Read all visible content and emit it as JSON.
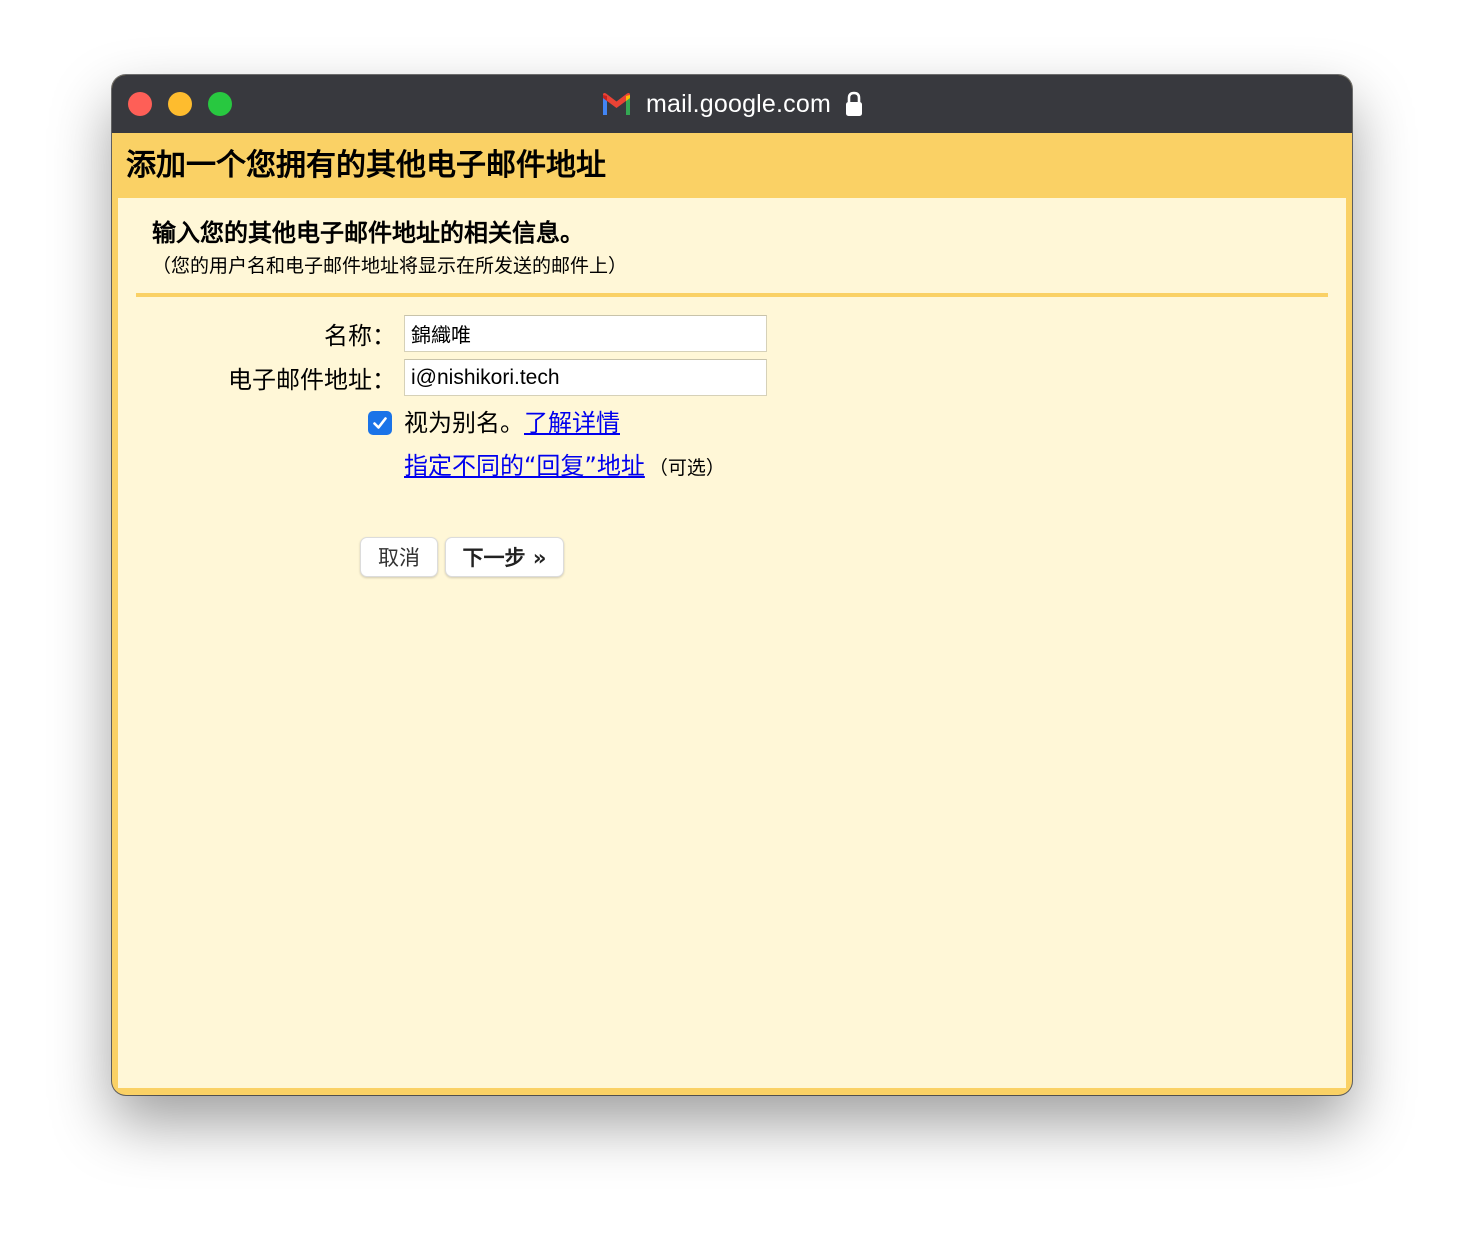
{
  "window": {
    "url": "mail.google.com",
    "icons": [
      "gmail-icon",
      "lock-icon"
    ]
  },
  "dialog": {
    "title": "添加一个您拥有的其他电子邮件地址",
    "subtitle": "输入您的其他电子邮件地址的相关信息。",
    "note": "（您的用户名和电子邮件地址将显示在所发送的邮件上）"
  },
  "form": {
    "name_label": "名称：",
    "name_value": "錦織唯",
    "email_label": "电子邮件地址：",
    "email_value": "i@nishikori.tech",
    "alias_checked": true,
    "alias_label": "视为别名。",
    "learn_more_link": "了解详情",
    "reply_to_link": "指定不同的“回复”地址",
    "reply_to_optional": "（可选）"
  },
  "buttons": {
    "cancel": "取消",
    "next": "下一步 »"
  },
  "colors": {
    "header": "#fad165",
    "content_bg": "#fff7d7",
    "titlebar": "#38393e",
    "checkbox": "#1a73e8",
    "link": "#0000ee"
  }
}
